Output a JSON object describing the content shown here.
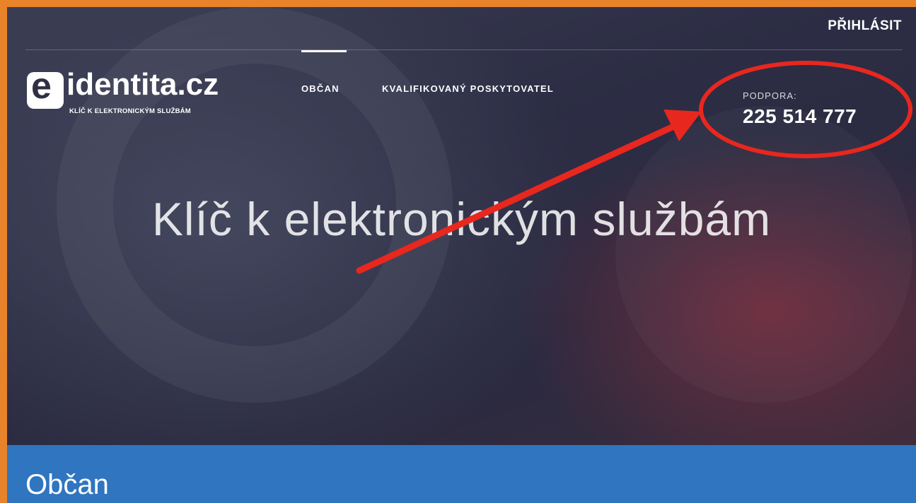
{
  "header": {
    "login_label": "PŘIHLÁSIT"
  },
  "logo": {
    "e_letter": "e",
    "wordmark": "identita.cz",
    "tagline": "KLÍČ K ELEKTRONICKÝM SLUŽBÁM"
  },
  "nav": {
    "items": [
      {
        "label": "OBČAN",
        "active": true
      },
      {
        "label": "KVALIFIKOVANÝ POSKYTOVATEL",
        "active": false
      }
    ]
  },
  "support": {
    "label": "PODPORA:",
    "phone": "225 514 777"
  },
  "hero": {
    "headline": "Klíč k elektronickým službám"
  },
  "section": {
    "title": "Občan"
  },
  "colors": {
    "frame": "#e8832a",
    "band": "#2f75bf",
    "annotation": "#e8271e"
  }
}
